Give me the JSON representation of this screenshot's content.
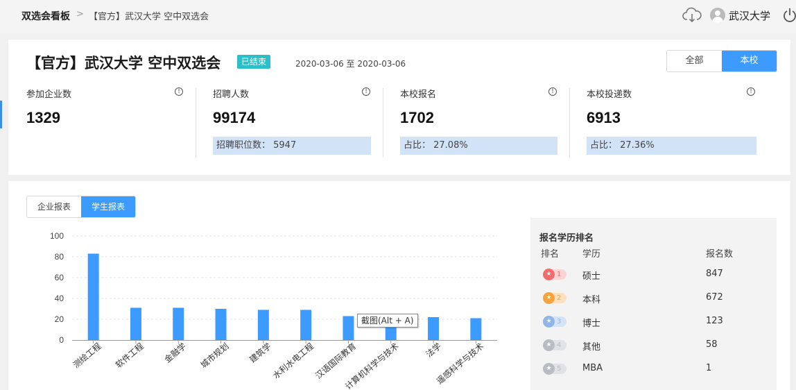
{
  "breadcrumb": {
    "root": "双选会看板",
    "separator": ">",
    "current": "【官方】武汉大学 空中双选会"
  },
  "header": {
    "user_name": "武汉大学"
  },
  "fair": {
    "title": "【官方】武汉大学 空中双选会",
    "status": "已结束",
    "date_range": "2020-03-06 至 2020-03-06",
    "scope_options": [
      "全部",
      "本校"
    ],
    "scope_selected": "本校"
  },
  "stats": [
    {
      "label": "参加企业数",
      "value": "1329",
      "sub": ""
    },
    {
      "label": "招聘人数",
      "value": "99174",
      "sub": "招聘职位数：  5947"
    },
    {
      "label": "本校报名",
      "value": "1702",
      "sub": "占比：  27.08%"
    },
    {
      "label": "本校投递数",
      "value": "6913",
      "sub": "占比：  27.36%"
    }
  ],
  "report_tabs": [
    "企业报表",
    "学生报表"
  ],
  "report_tab_selected": "学生报表",
  "tooltip": "截图(Alt + A)",
  "chart_data": {
    "type": "bar",
    "categories": [
      "测绘工程",
      "软件工程",
      "金融学",
      "城市规划",
      "建筑学",
      "水利水电工程",
      "汉语国际教育",
      "计算机科学与技术",
      "法学",
      "遥感科学与技术"
    ],
    "values": [
      83,
      31,
      31,
      30,
      29,
      29,
      23,
      22,
      22,
      21
    ],
    "ylim": [
      0,
      100
    ],
    "yticks": [
      "0",
      "20",
      "40",
      "60",
      "80",
      "100"
    ],
    "grid": true,
    "bar_color": "#3d9bff"
  },
  "ranking": {
    "title": "报名学历排名",
    "columns": [
      "排名",
      "学历",
      "报名数"
    ],
    "rows": [
      {
        "rank": "1",
        "name": "硕士",
        "count": "847",
        "color": "#f36b6b",
        "bg": "#fbd3d3"
      },
      {
        "rank": "2",
        "name": "本科",
        "count": "672",
        "color": "#f7a23b",
        "bg": "#fde1bf"
      },
      {
        "rank": "3",
        "name": "博士",
        "count": "123",
        "color": "#8fb6e6",
        "bg": "#d5e3f6"
      },
      {
        "rank": "4",
        "name": "其他",
        "count": "58",
        "color": "#b9bcc2",
        "bg": "#e1e2e5"
      },
      {
        "rank": "5",
        "name": "MBA",
        "count": "1",
        "color": "#b9bcc2",
        "bg": "#e1e2e5"
      }
    ]
  }
}
